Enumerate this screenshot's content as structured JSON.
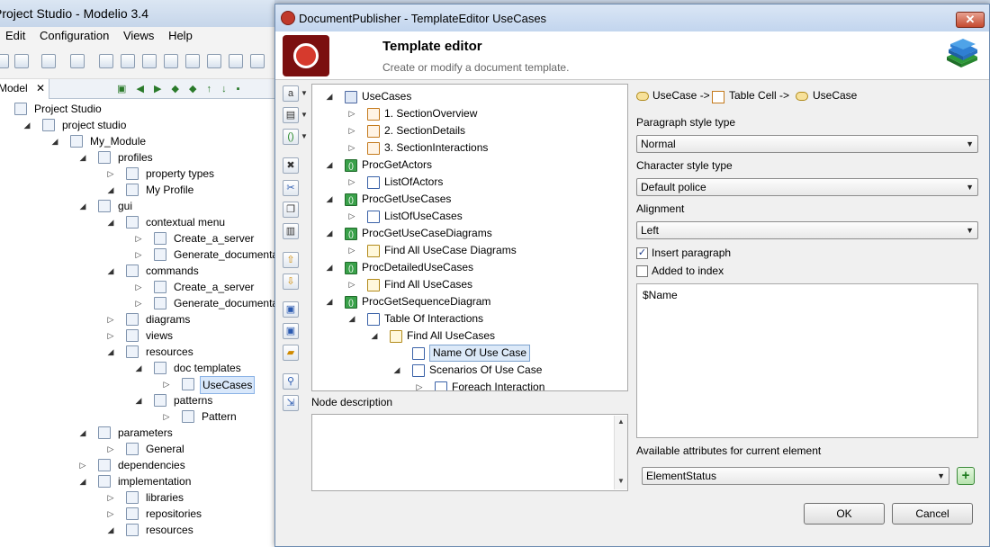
{
  "app": {
    "title": "Project Studio - Modelio 3.4",
    "menu": [
      "Edit",
      "Configuration",
      "Views",
      "Help"
    ],
    "model_tab": "Model",
    "tree": [
      {
        "label": "Project Studio",
        "indent": 0
      },
      {
        "label": "project studio",
        "indent": 1
      },
      {
        "label": "My_Module",
        "indent": 2
      },
      {
        "label": "profiles",
        "indent": 3
      },
      {
        "label": "property types",
        "indent": 4
      },
      {
        "label": "My Profile",
        "indent": 4
      },
      {
        "label": "gui",
        "indent": 3
      },
      {
        "label": "contextual menu",
        "indent": 4
      },
      {
        "label": "Create_a_server",
        "indent": 5
      },
      {
        "label": "Generate_documentation",
        "indent": 5
      },
      {
        "label": "commands",
        "indent": 4
      },
      {
        "label": "Create_a_server",
        "indent": 5
      },
      {
        "label": "Generate_documentation",
        "indent": 5
      },
      {
        "label": "diagrams",
        "indent": 4
      },
      {
        "label": "views",
        "indent": 4
      },
      {
        "label": "resources",
        "indent": 4
      },
      {
        "label": "doc templates",
        "indent": 5
      },
      {
        "label": "UseCases",
        "indent": 6
      },
      {
        "label": "patterns",
        "indent": 5
      },
      {
        "label": "Pattern",
        "indent": 6
      },
      {
        "label": "parameters",
        "indent": 3
      },
      {
        "label": "General",
        "indent": 4
      },
      {
        "label": "dependencies",
        "indent": 3
      },
      {
        "label": "implementation",
        "indent": 3
      },
      {
        "label": "libraries",
        "indent": 4
      },
      {
        "label": "repositories",
        "indent": 4
      },
      {
        "label": "resources",
        "indent": 4
      }
    ]
  },
  "dialog": {
    "title": "DocumentPublisher - TemplateEditor UseCases",
    "close_label": "✕",
    "header_title": "Template editor",
    "header_subtitle": "Create or modify a document template.",
    "template_tree": [
      {
        "label": "UseCases",
        "indent": 0,
        "icon": "root"
      },
      {
        "label": "1. SectionOverview",
        "indent": 1,
        "icon": "doc"
      },
      {
        "label": "2. SectionDetails",
        "indent": 1,
        "icon": "doc"
      },
      {
        "label": "3. SectionInteractions",
        "indent": 1,
        "icon": "doc"
      },
      {
        "label": "ProcGetActors",
        "indent": 0,
        "icon": "proc"
      },
      {
        "label": "ListOfActors",
        "indent": 1,
        "icon": "tbl"
      },
      {
        "label": "ProcGetUseCases",
        "indent": 0,
        "icon": "proc"
      },
      {
        "label": "ListOfUseCases",
        "indent": 1,
        "icon": "tbl"
      },
      {
        "label": "ProcGetUseCaseDiagrams",
        "indent": 0,
        "icon": "proc"
      },
      {
        "label": "Find All UseCase Diagrams",
        "indent": 1,
        "icon": "find"
      },
      {
        "label": "ProcDetailedUseCases",
        "indent": 0,
        "icon": "proc"
      },
      {
        "label": "Find All UseCases",
        "indent": 1,
        "icon": "find"
      },
      {
        "label": "ProcGetSequenceDiagram",
        "indent": 0,
        "icon": "proc"
      },
      {
        "label": "Table Of Interactions",
        "indent": 1,
        "icon": "tbl"
      },
      {
        "label": "Find All UseCases",
        "indent": 2,
        "icon": "find"
      },
      {
        "label": "Name Of Use Case",
        "indent": 3,
        "icon": "name"
      },
      {
        "label": "Scenarios Of Use Case",
        "indent": 3,
        "icon": "tbl"
      },
      {
        "label": "Foreach Interaction",
        "indent": 4,
        "icon": "name"
      }
    ],
    "node_description_label": "Node description",
    "breadcrumb": [
      "UseCase ->",
      "Table Cell ->",
      "UseCase"
    ],
    "paragraph_style_label": "Paragraph style type",
    "paragraph_style_value": "Normal",
    "character_style_label": "Character style type",
    "character_style_value": "Default police",
    "alignment_label": "Alignment",
    "alignment_value": "Left",
    "insert_paragraph_label": "Insert paragraph",
    "insert_paragraph_checked": true,
    "added_to_index_label": "Added to index",
    "added_to_index_checked": false,
    "value_text": "$Name",
    "available_attributes_label": "Available attributes for current element",
    "available_attributes_value": "ElementStatus",
    "ok_label": "OK",
    "cancel_label": "Cancel"
  }
}
